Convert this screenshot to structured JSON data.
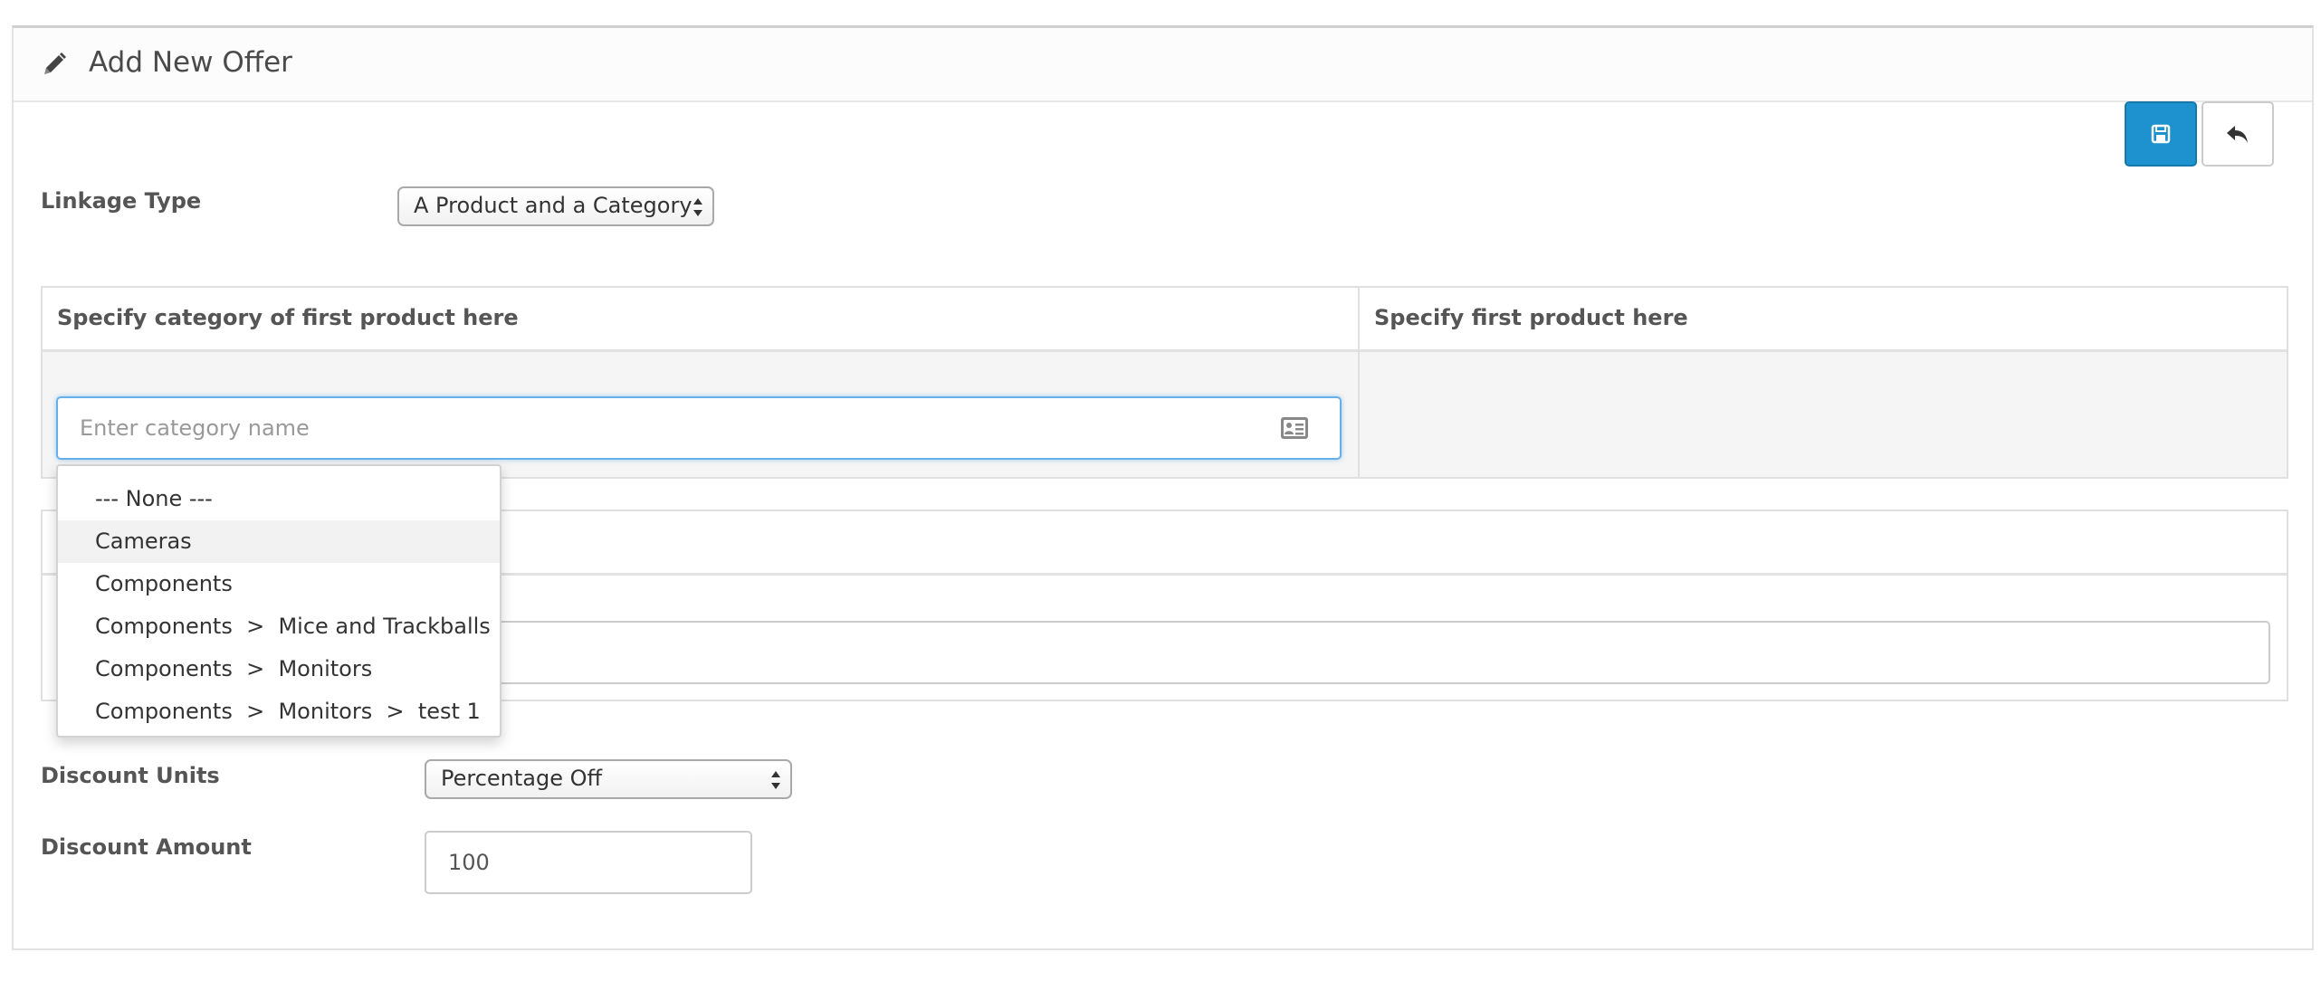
{
  "panel": {
    "title": "Add New Offer",
    "icon": "pencil-icon"
  },
  "toolbar": {
    "save_icon": "save-icon",
    "back_icon": "reply-icon",
    "save_color": "#1e91cf"
  },
  "linkage": {
    "label": "Linkage Type",
    "selected": "A Product and a Category"
  },
  "first_table": {
    "category_header": "Specify category of first product here",
    "product_header": "Specify first product here",
    "category_input": {
      "value": "",
      "placeholder": "Enter category name"
    }
  },
  "category_dropdown": {
    "items": [
      "--- None ---",
      "Cameras",
      "Components",
      "Components  >  Mice and Trackballs",
      "Components  >  Monitors",
      "Components  >  Monitors  >  test 1"
    ],
    "hovered_index": 1
  },
  "second_table": {
    "input_value": ""
  },
  "discount_units": {
    "label": "Discount Units",
    "selected": "Percentage Off"
  },
  "discount_amount": {
    "label": "Discount Amount",
    "value": "100"
  }
}
